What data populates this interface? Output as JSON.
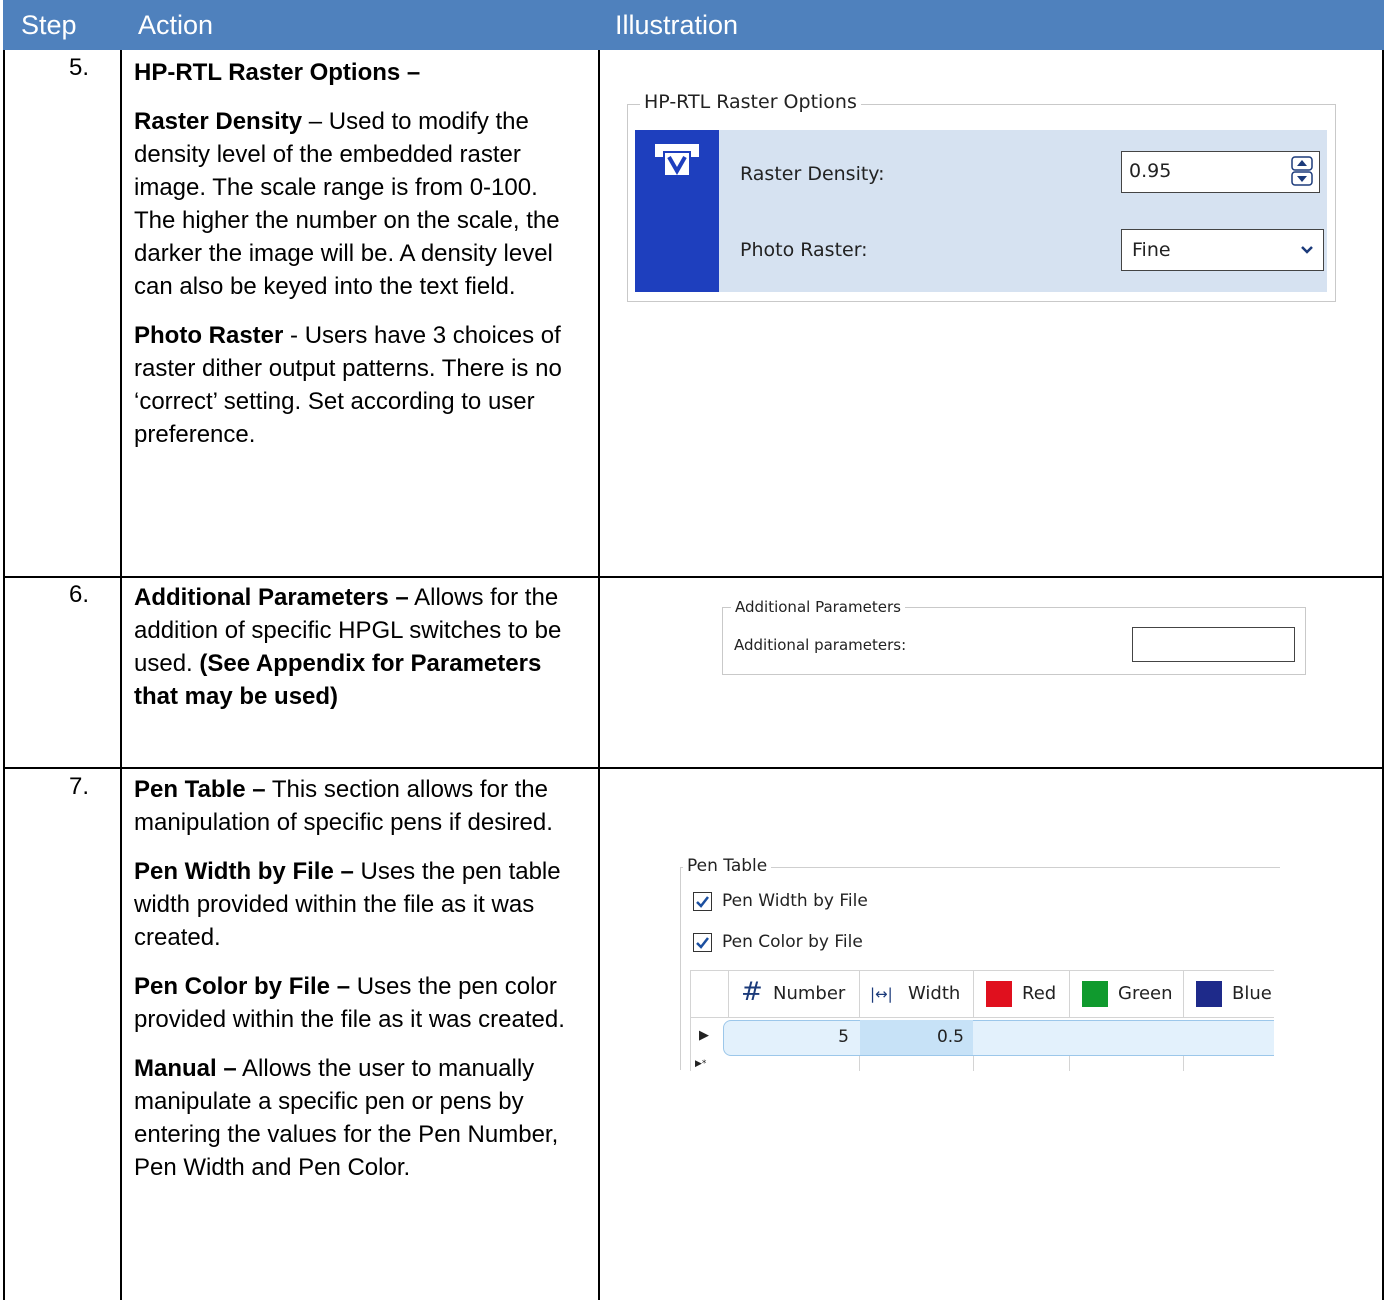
{
  "header": {
    "step": "Step",
    "action": "Action",
    "illustration": "Illustration"
  },
  "rows": [
    {
      "step": "5.",
      "action": {
        "p1_bold": "HP-RTL Raster Options –",
        "p2_bold": "Raster Density",
        "p2_text": " – Used to modify the density level of the embedded raster image. The scale range is from 0-100. The higher the number on the scale, the darker the image will be.  A density level can also be keyed into the text field.",
        "p3_bold": "Photo Raster",
        "p3_text": " - Users have 3 choices of raster dither output patterns. There is no ‘correct’ setting.   Set according to user preference."
      }
    },
    {
      "step": "6.",
      "action": {
        "p1_bold": "Additional Parameters –",
        "p1_text": " Allows for the addition of specific HPGL switches to be used. ",
        "p1_bold2": " (See Appendix for Parameters that may be used)"
      }
    },
    {
      "step": "7.",
      "action": {
        "p1_bold": "Pen Table –",
        "p1_text": " This section allows for the manipulation of specific pens if desired.",
        "p2_bold": "Pen Width by File –",
        "p2_text": " Uses the pen table width provided within the file as it was created.",
        "p3_bold": "Pen Color by File –",
        "p3_text": " Uses the pen color provided within the file as it was created.",
        "p4_bold": "Manual –",
        "p4_text": " Allows the user to manually manipulate a specific pen or pens by entering the values for the Pen Number, Pen Width and Pen Color."
      }
    }
  ],
  "raster_options": {
    "group_title": "HP-RTL Raster Options",
    "density_label": "Raster Density:",
    "density_value": "0.95",
    "photo_label": "Photo Raster:",
    "photo_value": "Fine",
    "icon": "raster-icon",
    "accent_color": "#1e3fbe",
    "panel_color": "#d6e2f1"
  },
  "additional_parameters": {
    "group_title": "Additional Parameters",
    "label": "Additional parameters:",
    "value": ""
  },
  "pen_table": {
    "group_title": "Pen Table",
    "width_by_file_label": "Pen Width by File",
    "width_by_file_checked": true,
    "color_by_file_label": "Pen Color by File",
    "color_by_file_checked": true,
    "columns": [
      {
        "label": "Number",
        "icon": "hash-icon"
      },
      {
        "label": "Width",
        "icon": "width-arrows-icon"
      },
      {
        "label": "Red",
        "color": "#e0101e"
      },
      {
        "label": "Green",
        "color": "#109a2e"
      },
      {
        "label": "Blue",
        "color": "#1e2a8a"
      }
    ],
    "rows": [
      {
        "number": "5",
        "width": "0.5",
        "red": "",
        "green": "",
        "blue": ""
      }
    ]
  }
}
